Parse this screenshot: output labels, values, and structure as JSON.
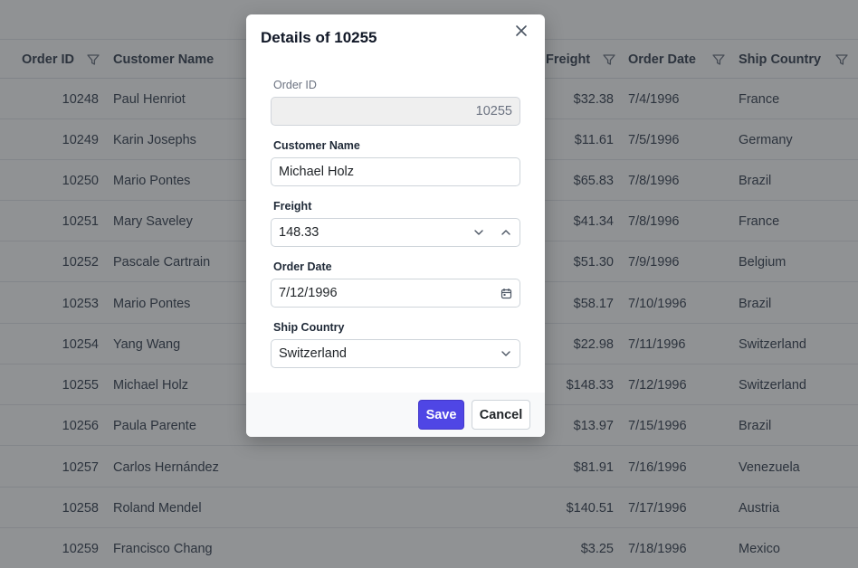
{
  "grid": {
    "columns": {
      "order_id": "Order ID",
      "customer_name": "Customer Name",
      "freight": "Freight",
      "order_date": "Order Date",
      "ship_country": "Ship Country"
    },
    "rows": [
      {
        "id": "10248",
        "name": "Paul Henriot",
        "freight": "$32.38",
        "date": "7/4/1996",
        "country": "France"
      },
      {
        "id": "10249",
        "name": "Karin Josephs",
        "freight": "$11.61",
        "date": "7/5/1996",
        "country": "Germany"
      },
      {
        "id": "10250",
        "name": "Mario Pontes",
        "freight": "$65.83",
        "date": "7/8/1996",
        "country": "Brazil"
      },
      {
        "id": "10251",
        "name": "Mary Saveley",
        "freight": "$41.34",
        "date": "7/8/1996",
        "country": "France"
      },
      {
        "id": "10252",
        "name": "Pascale Cartrain",
        "freight": "$51.30",
        "date": "7/9/1996",
        "country": "Belgium"
      },
      {
        "id": "10253",
        "name": "Mario Pontes",
        "freight": "$58.17",
        "date": "7/10/1996",
        "country": "Brazil"
      },
      {
        "id": "10254",
        "name": "Yang Wang",
        "freight": "$22.98",
        "date": "7/11/1996",
        "country": "Switzerland"
      },
      {
        "id": "10255",
        "name": "Michael Holz",
        "freight": "$148.33",
        "date": "7/12/1996",
        "country": "Switzerland"
      },
      {
        "id": "10256",
        "name": "Paula Parente",
        "freight": "$13.97",
        "date": "7/15/1996",
        "country": "Brazil"
      },
      {
        "id": "10257",
        "name": "Carlos Hernández",
        "freight": "$81.91",
        "date": "7/16/1996",
        "country": "Venezuela"
      },
      {
        "id": "10258",
        "name": "Roland Mendel",
        "freight": "$140.51",
        "date": "7/17/1996",
        "country": "Austria"
      },
      {
        "id": "10259",
        "name": "Francisco Chang",
        "freight": "$3.25",
        "date": "7/18/1996",
        "country": "Mexico"
      }
    ]
  },
  "dialog": {
    "title": "Details of 10255",
    "close_icon": "close-icon",
    "fields": {
      "order_id": {
        "label": "Order ID",
        "value": "10255"
      },
      "customer_name": {
        "label": "Customer Name",
        "value": "Michael Holz"
      },
      "freight": {
        "label": "Freight",
        "value": "148.33"
      },
      "order_date": {
        "label": "Order Date",
        "value": "7/12/1996"
      },
      "ship_country": {
        "label": "Ship Country",
        "value": "Switzerland"
      }
    },
    "save_label": "Save",
    "cancel_label": "Cancel"
  },
  "colors": {
    "primary": "#4f46e5",
    "overlay": "rgba(33,37,41,0.5)"
  }
}
